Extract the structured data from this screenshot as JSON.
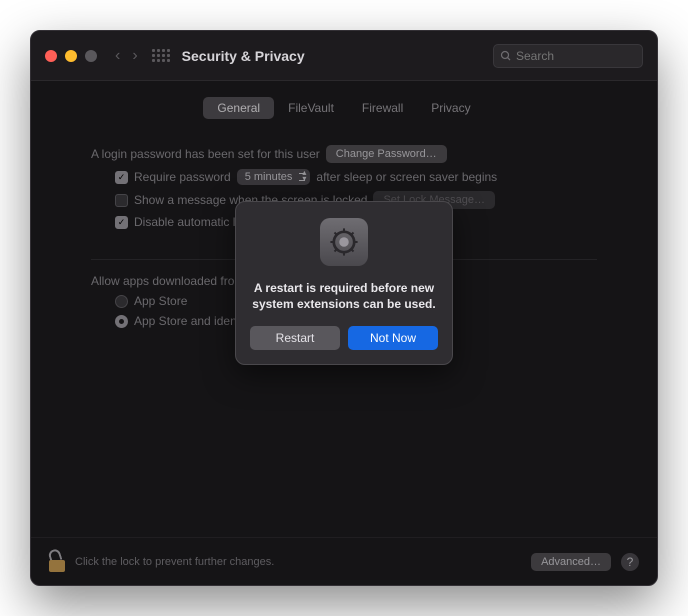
{
  "window": {
    "title": "Security & Privacy",
    "search_placeholder": "Search"
  },
  "tabs": {
    "general": "General",
    "filevault": "FileVault",
    "firewall": "Firewall",
    "privacy": "Privacy"
  },
  "general": {
    "login_pw_set": "A login password has been set for this user",
    "change_password": "Change Password…",
    "require_pw": "Require password",
    "require_pw_delay": "5 minutes",
    "after_sleep": "after sleep or screen saver begins",
    "show_msg": "Show a message when the screen is locked",
    "set_lock_msg": "Set Lock Message…",
    "disable_auto": "Disable automatic login",
    "allow_apps": "Allow apps downloaded from:",
    "app_store": "App Store",
    "app_store_dev": "App Store and identified developers"
  },
  "footer": {
    "lock_text": "Click the lock to prevent further changes.",
    "advanced": "Advanced…"
  },
  "modal": {
    "message": "A restart is required before new system extensions can be used.",
    "restart": "Restart",
    "not_now": "Not Now"
  },
  "colors": {
    "accent": "#1668e3"
  }
}
